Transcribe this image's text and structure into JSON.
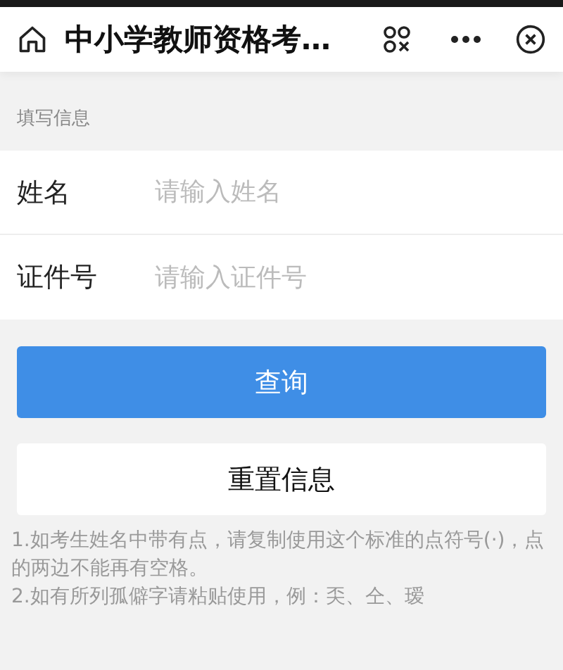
{
  "header": {
    "title": "中小学教师资格考…"
  },
  "section_label": "填写信息",
  "fields": [
    {
      "label": "姓名",
      "placeholder": "请输入姓名"
    },
    {
      "label": "证件号",
      "placeholder": "请输入证件号"
    }
  ],
  "buttons": [
    {
      "kind": "primary",
      "label": "查询"
    },
    {
      "kind": "secondary",
      "label": "重置信息"
    }
  ],
  "notes": [
    "1.如考生姓名中带有点，请复制使用这个标准的点符号(·)，点的两边不能再有空格。",
    "2.如有所列孤僻字请粘贴使用，例：奀、仝、瑷"
  ]
}
